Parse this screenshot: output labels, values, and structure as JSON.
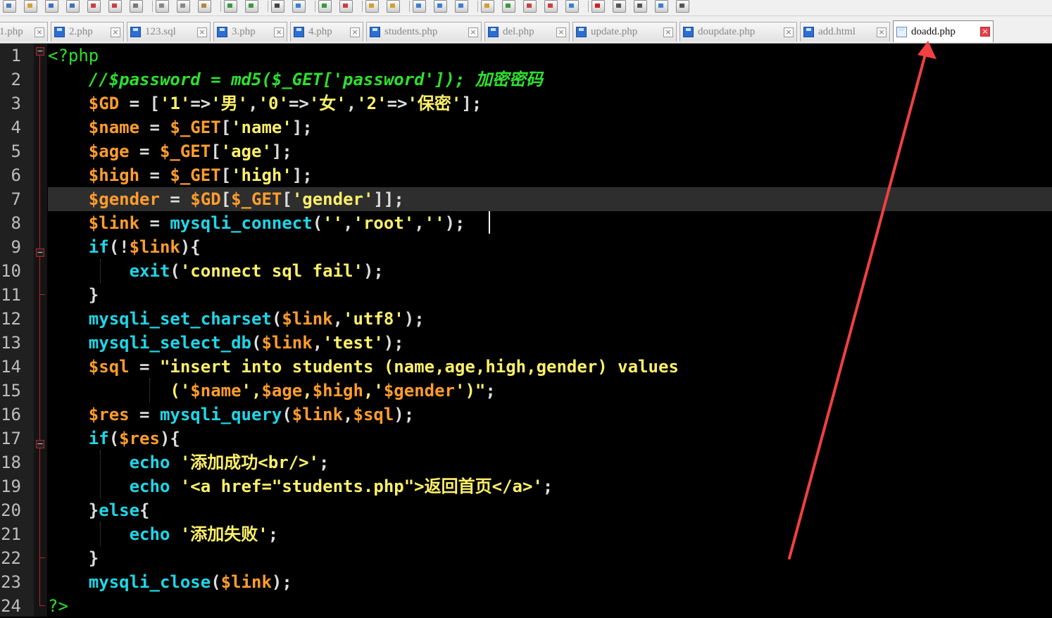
{
  "toolbar": {
    "buttons": [
      {
        "icon": "new-file-icon",
        "color": "#4a7cc0"
      },
      {
        "icon": "open-file-icon",
        "color": "#d8a030"
      },
      {
        "icon": "save-icon",
        "color": "#3f6fbf"
      },
      {
        "icon": "save-all-icon",
        "color": "#3f6fbf"
      },
      {
        "icon": "close-icon",
        "color": "#c84040"
      },
      {
        "icon": "close-all-icon",
        "color": "#c84040"
      },
      {
        "icon": "print-icon",
        "color": "#777777"
      },
      {
        "icon": "cut-icon",
        "color": "#888888"
      },
      {
        "icon": "copy-icon",
        "color": "#888888"
      },
      {
        "icon": "paste-icon",
        "color": "#b08a40"
      },
      {
        "icon": "undo-icon",
        "color": "#3a9a3a"
      },
      {
        "icon": "redo-icon",
        "color": "#3a9a3a"
      },
      {
        "icon": "find-icon",
        "color": "#444444"
      },
      {
        "icon": "replace-icon",
        "color": "#3b7fd0"
      },
      {
        "icon": "zoom-in-icon",
        "color": "#3a9a3a"
      },
      {
        "icon": "zoom-out-icon",
        "color": "#c84040"
      },
      {
        "icon": "sync-vertical-icon",
        "color": "#d0a030"
      },
      {
        "icon": "sync-horizontal-icon",
        "color": "#d0a030"
      },
      {
        "icon": "word-wrap-icon",
        "color": "#3b7fd0"
      },
      {
        "icon": "show-all-chars-icon",
        "color": "#3b7fd0"
      },
      {
        "icon": "indent-guide-icon",
        "color": "#3b7fd0"
      },
      {
        "icon": "user-language-icon",
        "color": "#d0a030"
      },
      {
        "icon": "doc-map-icon",
        "color": "#3a9a3a"
      },
      {
        "icon": "function-list-icon",
        "color": "#c84040"
      },
      {
        "icon": "folder-workspace-icon",
        "color": "#c84040"
      },
      {
        "icon": "monitoring-icon",
        "color": "#3b7fd0"
      },
      {
        "icon": "record-macro-icon",
        "color": "#d02020"
      },
      {
        "icon": "stop-macro-icon",
        "color": "#555555"
      },
      {
        "icon": "play-macro-icon",
        "color": "#555555"
      },
      {
        "icon": "run-macro-multiple-icon",
        "color": "#3b7fd0"
      },
      {
        "icon": "save-macro-icon",
        "color": "#555555"
      }
    ]
  },
  "tabs": [
    {
      "label": "1.php",
      "active": false
    },
    {
      "label": "2.php",
      "active": false
    },
    {
      "label": "123.sql",
      "active": false
    },
    {
      "label": "3.php",
      "active": false
    },
    {
      "label": "4.php",
      "active": false
    },
    {
      "label": "students.php",
      "active": false
    },
    {
      "label": "del.php",
      "active": false
    },
    {
      "label": "update.php",
      "active": false
    },
    {
      "label": "doupdate.php",
      "active": false
    },
    {
      "label": "add.html",
      "active": false
    },
    {
      "label": "doadd.php",
      "active": true
    }
  ],
  "tab_close_glyph": "×",
  "editor": {
    "line_numbers": [
      "1",
      "2",
      "3",
      "4",
      "5",
      "6",
      "7",
      "8",
      "9",
      "10",
      "11",
      "12",
      "13",
      "14",
      "15",
      "16",
      "17",
      "18",
      "19",
      "20",
      "21",
      "22",
      "23",
      "24"
    ],
    "current_line": 7,
    "lines": [
      [
        {
          "t": "<?php",
          "c": "t"
        }
      ],
      [
        {
          "t": "    //$password = md5($_GET['password']); 加密密码",
          "c": "c"
        }
      ],
      [
        {
          "t": "    ",
          "c": "p"
        },
        {
          "t": "$GD",
          "c": "v"
        },
        {
          "t": " = [",
          "c": "p"
        },
        {
          "t": "'1'",
          "c": "s"
        },
        {
          "t": "=>",
          "c": "p"
        },
        {
          "t": "'男'",
          "c": "s"
        },
        {
          "t": ",",
          "c": "p"
        },
        {
          "t": "'0'",
          "c": "s"
        },
        {
          "t": "=>",
          "c": "p"
        },
        {
          "t": "'女'",
          "c": "s"
        },
        {
          "t": ",",
          "c": "p"
        },
        {
          "t": "'2'",
          "c": "s"
        },
        {
          "t": "=>",
          "c": "p"
        },
        {
          "t": "'保密'",
          "c": "s"
        },
        {
          "t": "];",
          "c": "p"
        }
      ],
      [
        {
          "t": "    ",
          "c": "p"
        },
        {
          "t": "$name",
          "c": "v"
        },
        {
          "t": " = ",
          "c": "p"
        },
        {
          "t": "$_GET",
          "c": "v"
        },
        {
          "t": "[",
          "c": "p"
        },
        {
          "t": "'name'",
          "c": "s"
        },
        {
          "t": "];",
          "c": "p"
        }
      ],
      [
        {
          "t": "    ",
          "c": "p"
        },
        {
          "t": "$age",
          "c": "v"
        },
        {
          "t": " = ",
          "c": "p"
        },
        {
          "t": "$_GET",
          "c": "v"
        },
        {
          "t": "[",
          "c": "p"
        },
        {
          "t": "'age'",
          "c": "s"
        },
        {
          "t": "];",
          "c": "p"
        }
      ],
      [
        {
          "t": "    ",
          "c": "p"
        },
        {
          "t": "$high",
          "c": "v"
        },
        {
          "t": " = ",
          "c": "p"
        },
        {
          "t": "$_GET",
          "c": "v"
        },
        {
          "t": "[",
          "c": "p"
        },
        {
          "t": "'high'",
          "c": "s"
        },
        {
          "t": "];",
          "c": "p"
        }
      ],
      [
        {
          "t": "    ",
          "c": "p"
        },
        {
          "t": "$gender",
          "c": "v"
        },
        {
          "t": " = ",
          "c": "p"
        },
        {
          "t": "$GD",
          "c": "v"
        },
        {
          "t": "[",
          "c": "p"
        },
        {
          "t": "$_GET",
          "c": "v"
        },
        {
          "t": "[",
          "c": "p"
        },
        {
          "t": "'gender'",
          "c": "s"
        },
        {
          "t": "]];",
          "c": "p"
        }
      ],
      [
        {
          "t": "    ",
          "c": "p"
        },
        {
          "t": "$link",
          "c": "v"
        },
        {
          "t": " = ",
          "c": "p"
        },
        {
          "t": "mysqli_connect",
          "c": "k"
        },
        {
          "t": "(",
          "c": "p"
        },
        {
          "t": "''",
          "c": "s"
        },
        {
          "t": ",",
          "c": "p"
        },
        {
          "t": "'root'",
          "c": "s"
        },
        {
          "t": ",",
          "c": "p"
        },
        {
          "t": "''",
          "c": "s"
        },
        {
          "t": ");",
          "c": "p"
        }
      ],
      [
        {
          "t": "    ",
          "c": "p"
        },
        {
          "t": "if",
          "c": "k"
        },
        {
          "t": "(!",
          "c": "p"
        },
        {
          "t": "$link",
          "c": "v"
        },
        {
          "t": "){",
          "c": "p"
        }
      ],
      [
        {
          "t": "        ",
          "c": "p"
        },
        {
          "t": "exit",
          "c": "k"
        },
        {
          "t": "(",
          "c": "p"
        },
        {
          "t": "'connect sql fail'",
          "c": "s"
        },
        {
          "t": ");",
          "c": "p"
        }
      ],
      [
        {
          "t": "    }",
          "c": "p"
        }
      ],
      [
        {
          "t": "    ",
          "c": "p"
        },
        {
          "t": "mysqli_set_charset",
          "c": "k"
        },
        {
          "t": "(",
          "c": "p"
        },
        {
          "t": "$link",
          "c": "v"
        },
        {
          "t": ",",
          "c": "p"
        },
        {
          "t": "'utf8'",
          "c": "s"
        },
        {
          "t": ");",
          "c": "p"
        }
      ],
      [
        {
          "t": "    ",
          "c": "p"
        },
        {
          "t": "mysqli_select_db",
          "c": "k"
        },
        {
          "t": "(",
          "c": "p"
        },
        {
          "t": "$link",
          "c": "v"
        },
        {
          "t": ",",
          "c": "p"
        },
        {
          "t": "'test'",
          "c": "s"
        },
        {
          "t": ");",
          "c": "p"
        }
      ],
      [
        {
          "t": "    ",
          "c": "p"
        },
        {
          "t": "$sql",
          "c": "v"
        },
        {
          "t": " = ",
          "c": "p"
        },
        {
          "t": "\"insert into students (name,age,high,gender) values",
          "c": "s"
        }
      ],
      [
        {
          "t": "            ('",
          "c": "s"
        },
        {
          "t": "$name",
          "c": "v"
        },
        {
          "t": "',",
          "c": "s"
        },
        {
          "t": "$age",
          "c": "v"
        },
        {
          "t": ",",
          "c": "s"
        },
        {
          "t": "$high",
          "c": "v"
        },
        {
          "t": ",'",
          "c": "s"
        },
        {
          "t": "$gender",
          "c": "v"
        },
        {
          "t": "')\"",
          "c": "s"
        },
        {
          "t": ";",
          "c": "p"
        }
      ],
      [
        {
          "t": "    ",
          "c": "p"
        },
        {
          "t": "$res",
          "c": "v"
        },
        {
          "t": " = ",
          "c": "p"
        },
        {
          "t": "mysqli_query",
          "c": "k"
        },
        {
          "t": "(",
          "c": "p"
        },
        {
          "t": "$link",
          "c": "v"
        },
        {
          "t": ",",
          "c": "p"
        },
        {
          "t": "$sql",
          "c": "v"
        },
        {
          "t": ");",
          "c": "p"
        }
      ],
      [
        {
          "t": "    ",
          "c": "p"
        },
        {
          "t": "if",
          "c": "k"
        },
        {
          "t": "(",
          "c": "p"
        },
        {
          "t": "$res",
          "c": "v"
        },
        {
          "t": "){",
          "c": "p"
        }
      ],
      [
        {
          "t": "        ",
          "c": "p"
        },
        {
          "t": "echo",
          "c": "k"
        },
        {
          "t": " ",
          "c": "p"
        },
        {
          "t": "'添加成功<br/>'",
          "c": "s"
        },
        {
          "t": ";",
          "c": "p"
        }
      ],
      [
        {
          "t": "        ",
          "c": "p"
        },
        {
          "t": "echo",
          "c": "k"
        },
        {
          "t": " ",
          "c": "p"
        },
        {
          "t": "'<a href=\"students.php\">返回首页</a>'",
          "c": "s"
        },
        {
          "t": ";",
          "c": "p"
        }
      ],
      [
        {
          "t": "    }",
          "c": "p"
        },
        {
          "t": "else",
          "c": "k"
        },
        {
          "t": "{",
          "c": "p"
        }
      ],
      [
        {
          "t": "        ",
          "c": "p"
        },
        {
          "t": "echo",
          "c": "k"
        },
        {
          "t": " ",
          "c": "p"
        },
        {
          "t": "'添加失败'",
          "c": "s"
        },
        {
          "t": ";",
          "c": "p"
        }
      ],
      [
        {
          "t": "    }",
          "c": "p"
        }
      ],
      [
        {
          "t": "    ",
          "c": "p"
        },
        {
          "t": "mysqli_close",
          "c": "k"
        },
        {
          "t": "(",
          "c": "p"
        },
        {
          "t": "$link",
          "c": "v"
        },
        {
          "t": ");",
          "c": "p"
        }
      ],
      [
        {
          "t": "?>",
          "c": "t"
        }
      ]
    ]
  },
  "fold_markers": {
    "open": "−"
  },
  "colors": {
    "keyword": "#1fd6e8",
    "variable": "#ff9d2e",
    "string": "#fcf06a",
    "comment": "#2ee02e",
    "arrow": "#f04040"
  }
}
